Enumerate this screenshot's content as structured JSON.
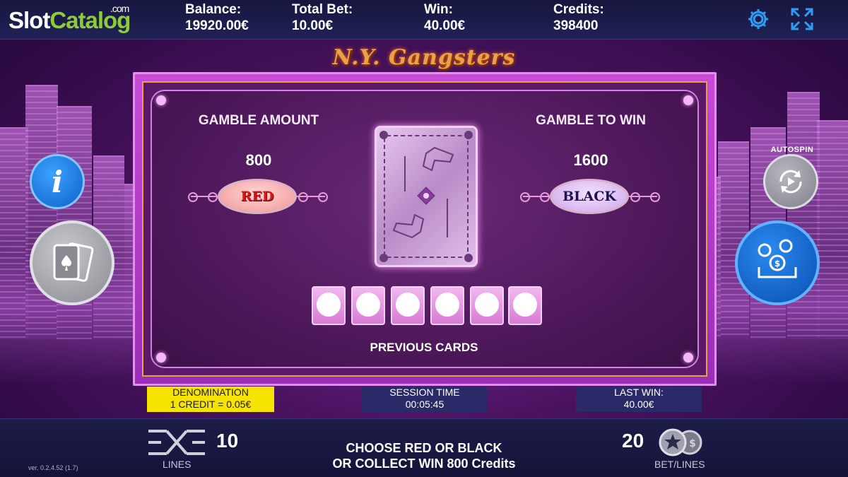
{
  "brand": {
    "logo_slot": "Slot",
    "logo_catalog": "Catalog",
    "logo_com": ".com"
  },
  "header": {
    "balance_label": "Balance:",
    "balance_value": "19920.00€",
    "total_bet_label": "Total Bet:",
    "total_bet_value": "10.00€",
    "win_label": "Win:",
    "win_value": "40.00€",
    "credits_label": "Credits:",
    "credits_value": "398400",
    "icons": [
      "gear-icon",
      "fullscreen-icon"
    ]
  },
  "game_title": "N.Y. Gangsters",
  "gamble": {
    "amount_label": "GAMBLE AMOUNT",
    "amount_value": "800",
    "to_win_label": "GAMBLE TO WIN",
    "to_win_value": "1600",
    "red_label": "RED",
    "black_label": "BLACK",
    "previous_cards_label": "PREVIOUS CARDS",
    "previous_cards_count": 6
  },
  "side": {
    "autospin_label": "AUTOSPIN"
  },
  "info_strip": {
    "denomination_title": "DENOMINATION",
    "denomination_value": "1 CREDIT = 0.05€",
    "session_title": "SESSION TIME",
    "session_value": "00:05:45",
    "last_win_title": "LAST WIN:",
    "last_win_value": "40.00€"
  },
  "footer": {
    "lines_value": "10",
    "lines_label": "LINES",
    "bet_value": "20",
    "bet_label": "BET/LINES",
    "message_line1": "CHOOSE RED OR BLACK",
    "message_line2": "OR COLLECT WIN 800 Credits",
    "version": "ver. 0.2.4.52 (1.7)"
  },
  "colors": {
    "accent_green": "#8ecb3a",
    "denom_yellow": "#f6e400",
    "frame_pink": "#c74ad6",
    "button_blue": "#1060c8"
  }
}
